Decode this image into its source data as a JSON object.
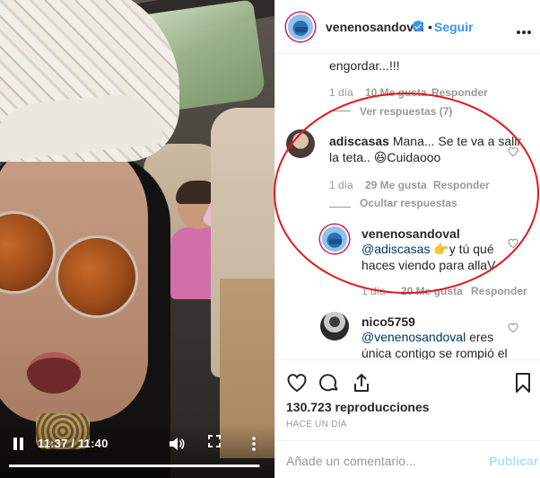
{
  "video": {
    "time_display": "11:37 / 11:40",
    "progress": 0.996,
    "icons": [
      "pause-icon",
      "volume-icon",
      "fullscreen-icon",
      "more-vertical-icon"
    ]
  },
  "header": {
    "username": "venenosandoval",
    "separator": "•",
    "follow_label": "Seguir",
    "verified": true
  },
  "comments": [
    {
      "text_line1": "engordar...!!!",
      "time": "1 día",
      "likes": "10 Me gusta",
      "reply": "Responder",
      "view_replies": "Ver respuestas (7)"
    },
    {
      "username": "adiscasas",
      "text_line1": "Mana... Se te va a salir",
      "text_line2": "la teta.. 😆Cuidaooo",
      "time": "1 día",
      "likes": "29 Me gusta",
      "reply": "Responder",
      "hide_replies": "Ocultar respuestas",
      "reply_item": {
        "username": "venenosandoval",
        "mention": "@adiscasas",
        "text_line1_rest": " 👉y tú qué",
        "text_line2": "haces viendo para allaV",
        "time": "1 día",
        "likes": "20 Me gusta",
        "reply": "Responder"
      }
    },
    {
      "username": "nico5759",
      "mention": "@venenosandoval",
      "text_line1_rest": " eres",
      "text_line2": "única contigo se rompió el"
    }
  ],
  "actions": {
    "views": "130.723 reproducciones",
    "posted": "HACE UN DÍA",
    "icons": [
      "heart-icon",
      "comment-icon",
      "share-icon",
      "bookmark-icon"
    ]
  },
  "add_comment": {
    "placeholder": "Añade un comentario...",
    "publish_label": "Publicar"
  },
  "colors": {
    "link_blue": "#3897f0",
    "annotation_red": "#e01a1a",
    "muted_gray": "#999999",
    "publish_disabled": "#b2dffc"
  }
}
